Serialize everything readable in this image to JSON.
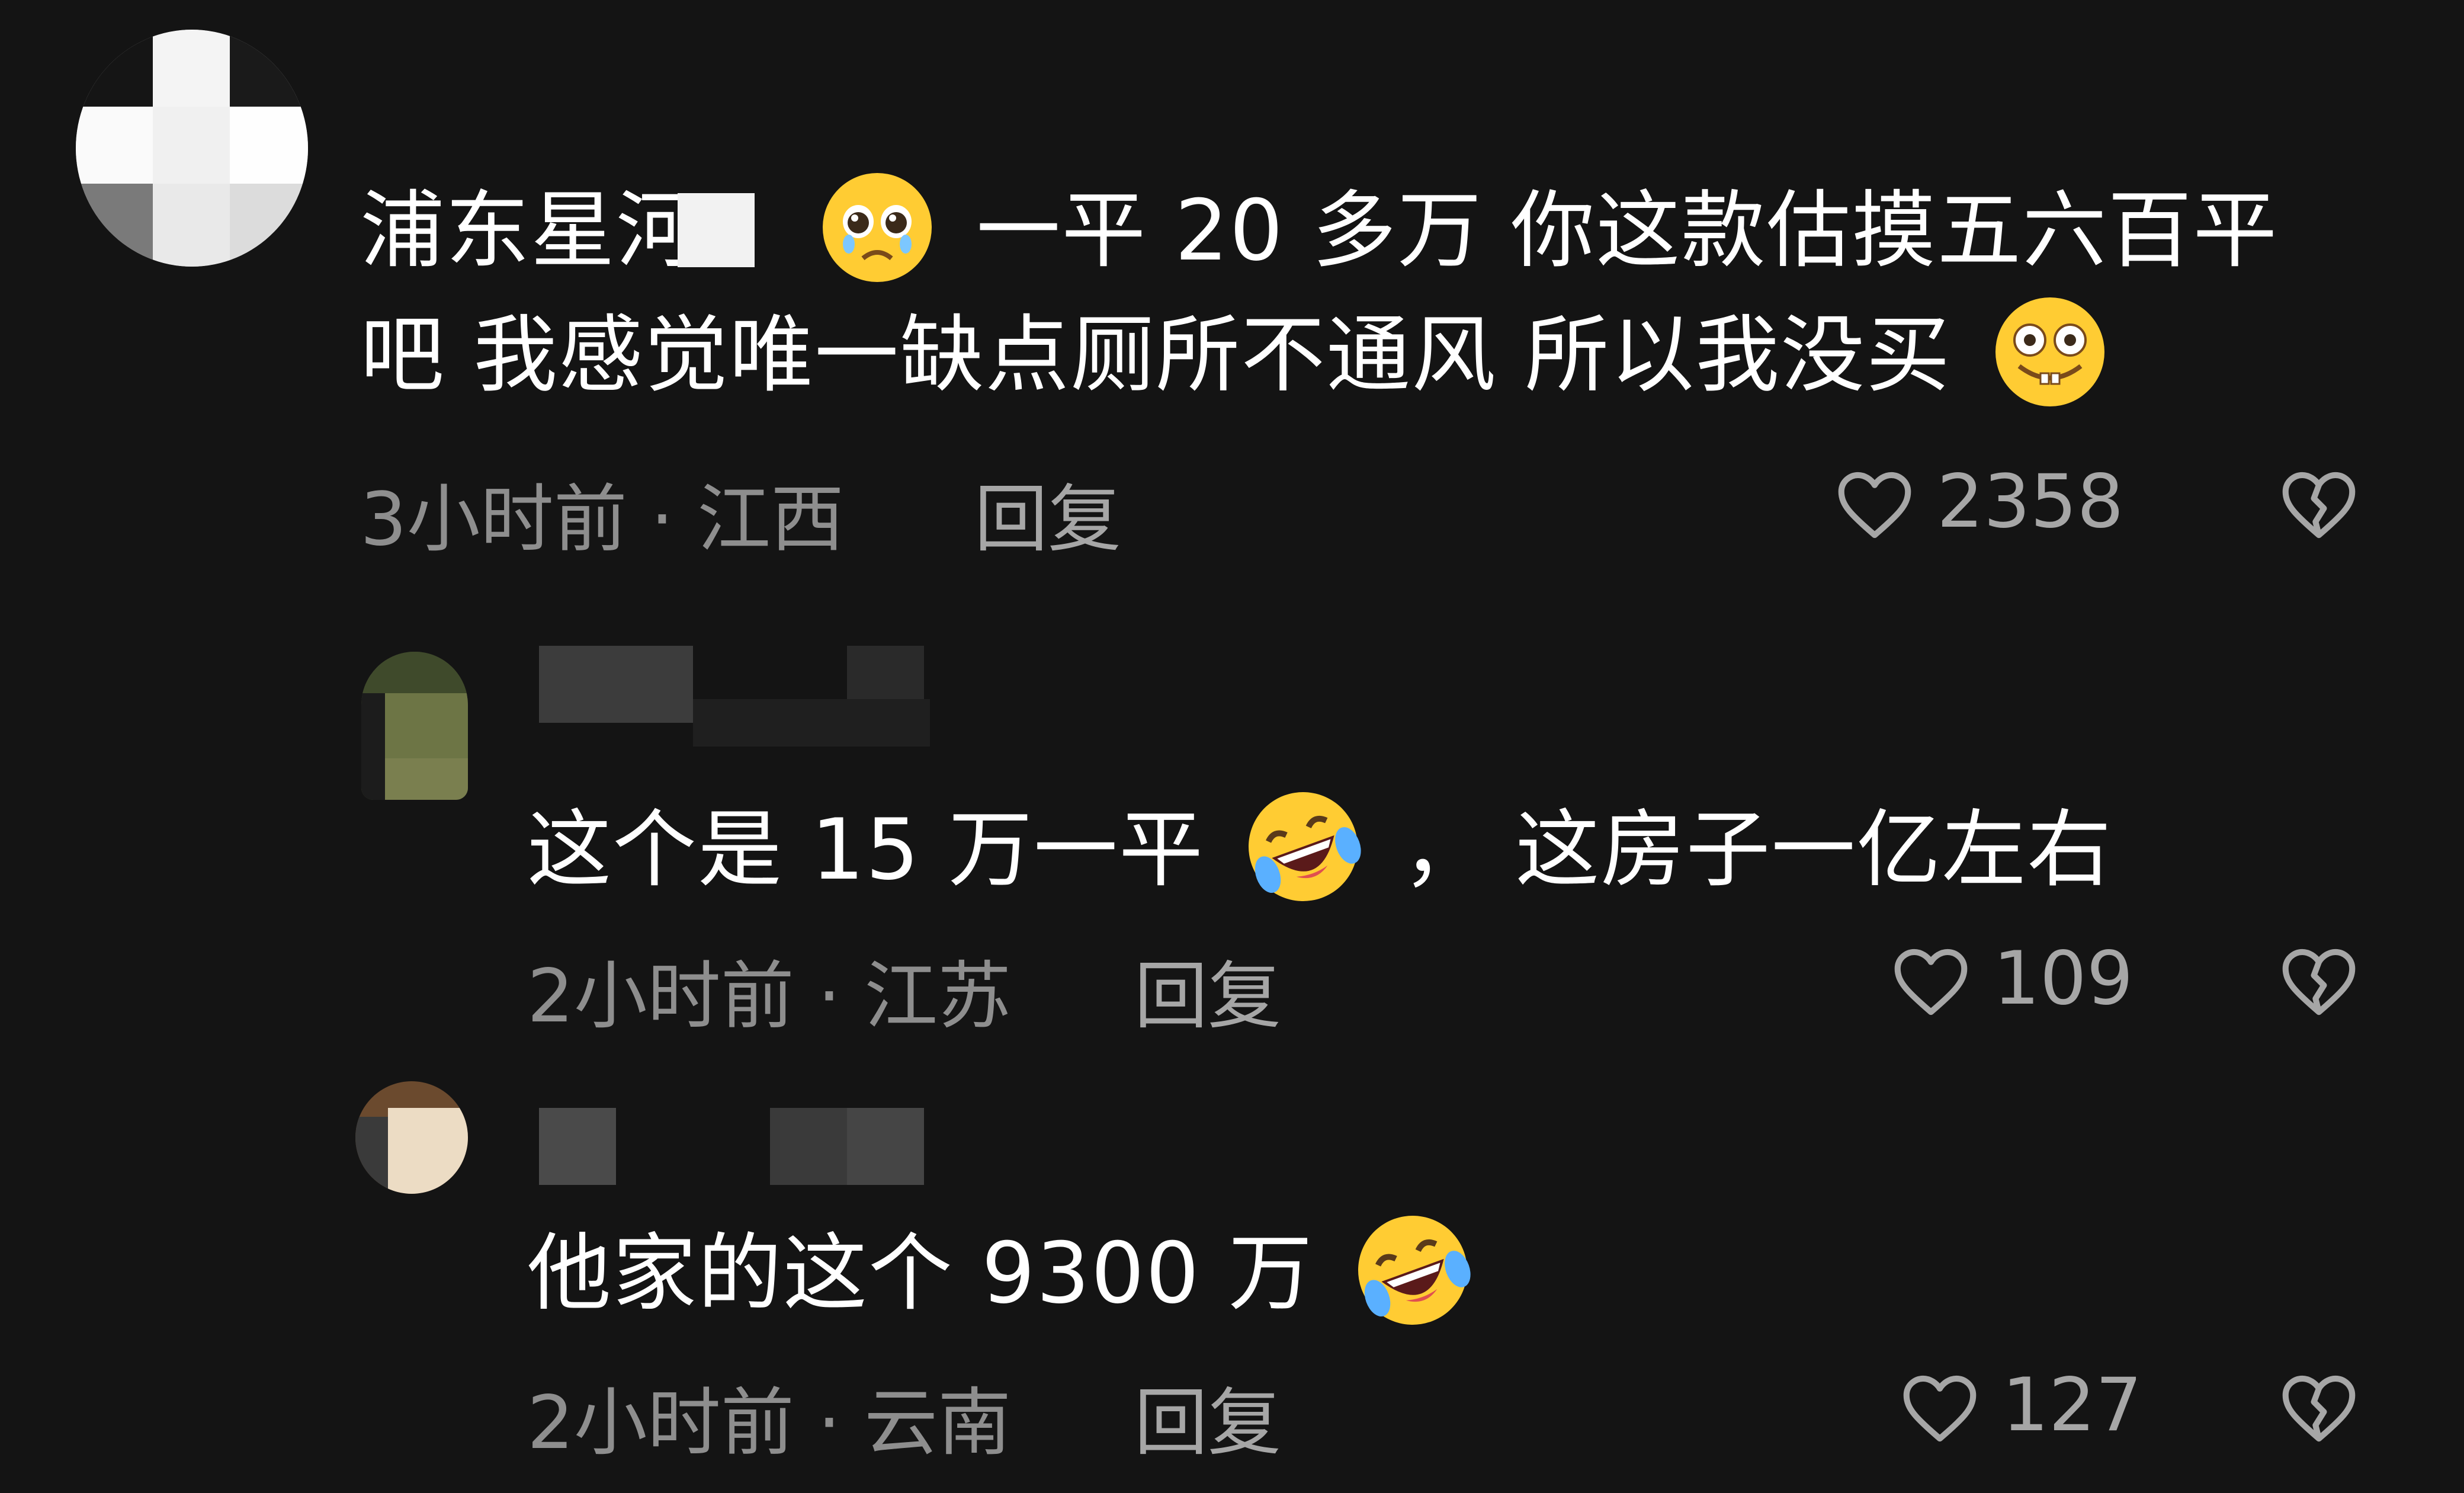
{
  "colors": {
    "background": "#141414",
    "text": "#ffffff",
    "meta": "#8e8e8e",
    "action": "#a6a6a6",
    "emoji_yellow": "#ffcc33"
  },
  "comments": [
    {
      "text_line1_a": "浦东星河",
      "text_line1_b": "一平 20 多万 你这款估摸五六百平",
      "text_line2": "吧  我感觉唯一缺点厕所不通风  所以我没买",
      "emoji_1": "pleading-face-icon",
      "emoji_2": "grinning-buck-teeth-icon",
      "meta": "3小时前 · 江西",
      "reply": "回复",
      "likes": "2358"
    },
    {
      "text_a": "这个是 15 万一平",
      "text_b": "，  这房子一亿左右",
      "emoji": "rolling-laughing-icon",
      "meta": "2小时前 · 江苏",
      "reply": "回复",
      "likes": "109"
    },
    {
      "text_a": "他家的这个 9300 万",
      "emoji": "rolling-laughing-icon",
      "meta": "2小时前 · 云南",
      "reply": "回复",
      "likes": "127"
    }
  ]
}
